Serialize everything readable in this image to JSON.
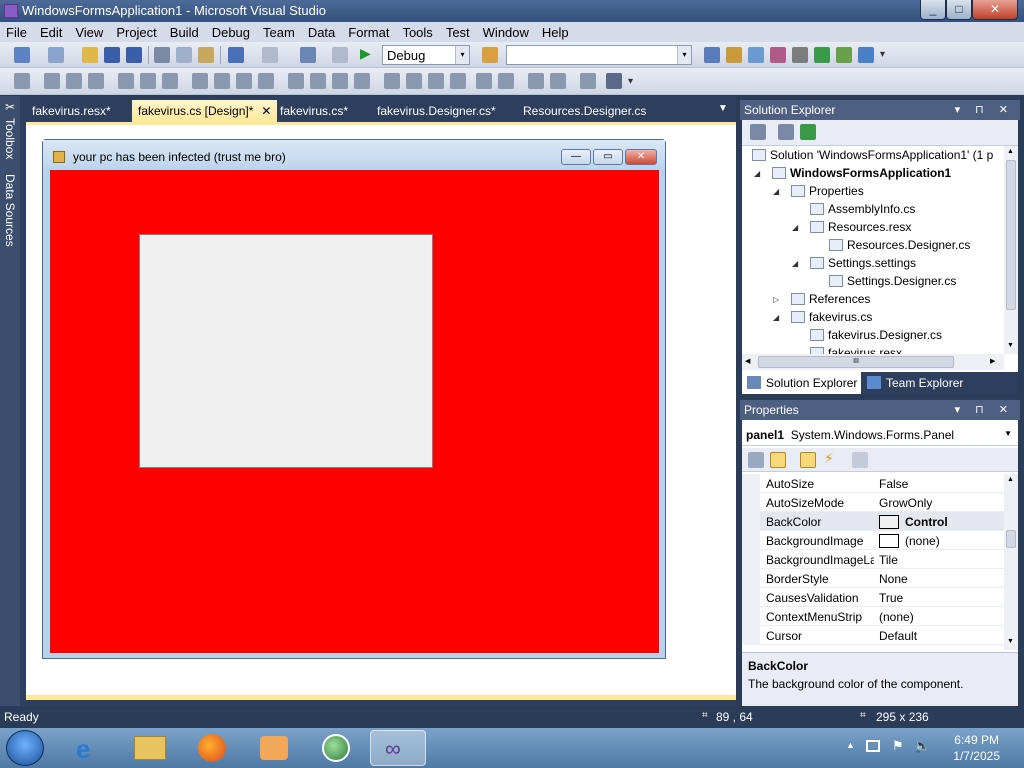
{
  "window": {
    "title": "WindowsFormsApplication1 - Microsoft Visual Studio",
    "btn_min": "_",
    "btn_max": "□",
    "btn_close": "✕"
  },
  "menu": [
    "File",
    "Edit",
    "View",
    "Project",
    "Build",
    "Debug",
    "Team",
    "Data",
    "Format",
    "Tools",
    "Test",
    "Window",
    "Help"
  ],
  "toolbar": {
    "config": "Debug",
    "platform": "",
    "arrow": "▾"
  },
  "left_strip": {
    "toolbox": "Toolbox",
    "data_sources": "Data Sources"
  },
  "doc_tabs": [
    {
      "label": "fakevirus.resx*",
      "active": false
    },
    {
      "label": "fakevirus.cs [Design]*",
      "active": true
    },
    {
      "label": "fakevirus.cs*",
      "active": false
    },
    {
      "label": "fakevirus.Designer.cs*",
      "active": false
    },
    {
      "label": "Resources.Designer.cs",
      "active": false
    }
  ],
  "tab_close": "✕",
  "tab_menu": "▼",
  "designer_form": {
    "title": "your pc has been infected (trust me bro)",
    "back_color": "#ff0000",
    "panel_color": "#f0f0f0",
    "btn_min": "—",
    "btn_max": "▭",
    "btn_close": "✕"
  },
  "solution_explorer": {
    "title": "Solution Explorer",
    "header_buttons": "▾ ⊓ ✕",
    "tree": [
      {
        "label": "Solution 'WindowsFormsApplication1' (1 p",
        "indent": 0,
        "bold": false,
        "expander": ""
      },
      {
        "label": "WindowsFormsApplication1",
        "indent": 1,
        "bold": true,
        "expander": "◢"
      },
      {
        "label": "Properties",
        "indent": 2,
        "bold": false,
        "expander": "◢"
      },
      {
        "label": "AssemblyInfo.cs",
        "indent": 3,
        "bold": false,
        "expander": ""
      },
      {
        "label": "Resources.resx",
        "indent": 3,
        "bold": false,
        "expander": "◢"
      },
      {
        "label": "Resources.Designer.cs",
        "indent": 4,
        "bold": false,
        "expander": ""
      },
      {
        "label": "Settings.settings",
        "indent": 3,
        "bold": false,
        "expander": "◢"
      },
      {
        "label": "Settings.Designer.cs",
        "indent": 4,
        "bold": false,
        "expander": ""
      },
      {
        "label": "References",
        "indent": 2,
        "bold": false,
        "expander": "▷"
      },
      {
        "label": "fakevirus.cs",
        "indent": 2,
        "bold": false,
        "expander": "◢"
      },
      {
        "label": "fakevirus.Designer.cs",
        "indent": 3,
        "bold": false,
        "expander": ""
      },
      {
        "label": "fakevirus.resx",
        "indent": 3,
        "bold": false,
        "expander": ""
      }
    ],
    "tabs": [
      {
        "label": "Solution Explorer",
        "active": true
      },
      {
        "label": "Team Explorer",
        "active": false
      }
    ],
    "hscroll_mid": "III",
    "scroll_up": "▲",
    "scroll_down": "▼",
    "scroll_left": "◀",
    "scroll_right": "▶"
  },
  "properties": {
    "title": "Properties",
    "header_buttons": "▾ ⊓ ✕",
    "object_name": "panel1",
    "object_type": "System.Windows.Forms.Panel",
    "rows": [
      {
        "name": "AutoSize",
        "value": "False",
        "swatch": false,
        "bold": false
      },
      {
        "name": "AutoSizeMode",
        "value": "GrowOnly",
        "swatch": false,
        "bold": false
      },
      {
        "name": "BackColor",
        "value": "Control",
        "swatch": true,
        "bold": true
      },
      {
        "name": "BackgroundImage",
        "value": "(none)",
        "swatch": true,
        "bold": false
      },
      {
        "name": "BackgroundImageLa",
        "value": "Tile",
        "swatch": false,
        "bold": false
      },
      {
        "name": "BorderStyle",
        "value": "None",
        "swatch": false,
        "bold": false
      },
      {
        "name": "CausesValidation",
        "value": "True",
        "swatch": false,
        "bold": false
      },
      {
        "name": "ContextMenuStrip",
        "value": "(none)",
        "swatch": false,
        "bold": false
      },
      {
        "name": "Cursor",
        "value": "Default",
        "swatch": false,
        "bold": false
      }
    ],
    "desc_title": "BackColor",
    "desc_text": "The background color of the component."
  },
  "status": {
    "text": "Ready",
    "position": "89 , 64",
    "size": "295 x 236"
  },
  "taskbar": {
    "time": "6:49 PM",
    "date": "1/7/2025"
  }
}
